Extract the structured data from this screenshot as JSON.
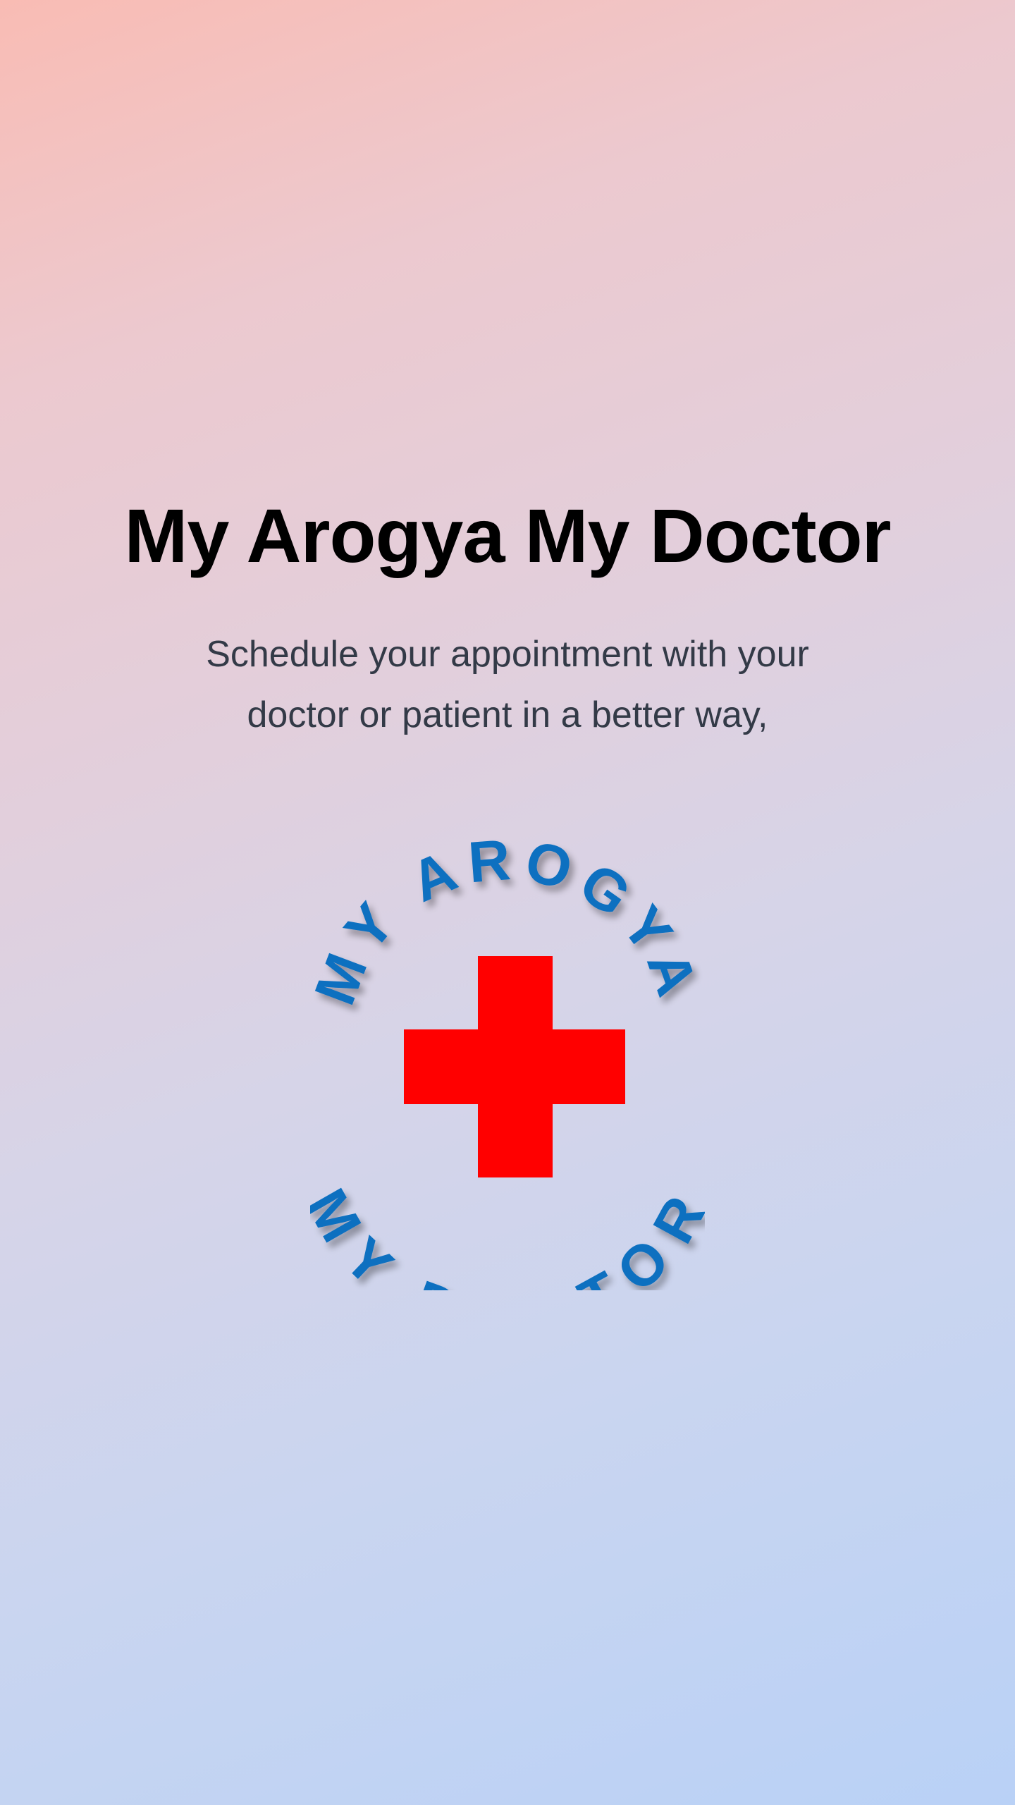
{
  "splash": {
    "title": "My Arogya My Doctor",
    "tagline_line1": "Schedule your appointment with your",
    "tagline_line2": "doctor or patient in a better way,"
  },
  "logo": {
    "top_text": "MY AROGYA",
    "bottom_text": "MY DOCTOR",
    "cross_color": "#ff0000",
    "text_color": "#0a6fc0",
    "icon": "red-cross-icon"
  }
}
